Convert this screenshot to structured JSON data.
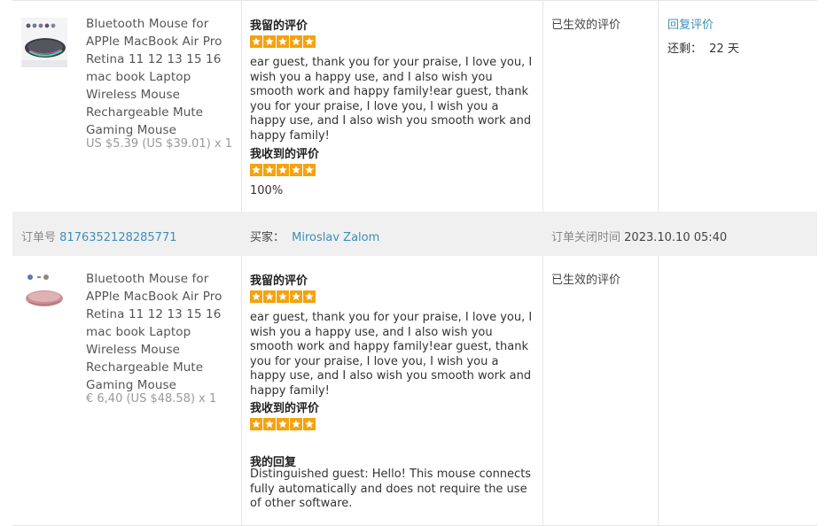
{
  "orders": [
    {
      "product": {
        "title": "Bluetooth Mouse for APPle MacBook Air Pro Retina 11 12 13 15 16 mac book Laptop Wireless Mouse Rechargeable Mute Gaming Mouse",
        "price": "US $5.39 (US $39.01) x 1",
        "image": "mouse-rgb-thumbnail"
      },
      "my_review": {
        "heading": "我留的评价",
        "stars": 5,
        "text": "ear guest, thank you for your praise, I love you, I wish you a happy use, and I also wish you smooth work and happy family!ear guest, thank you for your praise, I love you, I wish you a happy use, and I also wish you smooth work and happy family!"
      },
      "received_review": {
        "heading": "我收到的评价",
        "stars": 5,
        "score": "100%"
      },
      "status": "已生效的评价",
      "action": {
        "reply_label": "回复评价",
        "remaining_label": "还剩：",
        "remaining_value": "22 天"
      }
    },
    {
      "product": {
        "title": "Bluetooth Mouse for APPle MacBook Air Pro Retina 11 12 13 15 16 mac book Laptop Wireless Mouse Rechargeable Mute Gaming Mouse",
        "price": "€ 6,40 (US $48.58) x 1",
        "image": "mouse-pink-thumbnail"
      },
      "my_review": {
        "heading": "我留的评价",
        "stars": 5,
        "text": "ear guest, thank you for your praise, I love you, I wish you a happy use, and I also wish you smooth work and happy family!ear guest, thank you for your praise, I love you, I wish you a happy use, and I also wish you smooth work and happy family!"
      },
      "received_review": {
        "heading": "我收到的评价",
        "stars": 5
      },
      "my_reply": {
        "heading": "我的回复",
        "text": "Distinguished guest: Hello! This mouse connects fully automatically and does not require the use of other software."
      },
      "status": "已生效的评价"
    }
  ],
  "order_band": {
    "order_no_label": "订单号",
    "order_no": "8176352128285771",
    "buyer_label": "买家：",
    "buyer": "Miroslav Zalom",
    "closed_label": "订单关闭时间",
    "closed_time": "2023.10.10 05:40"
  },
  "colors": {
    "star": "#f5a20f",
    "link": "#3d8fb8",
    "band_bg": "#f0f0f0"
  }
}
